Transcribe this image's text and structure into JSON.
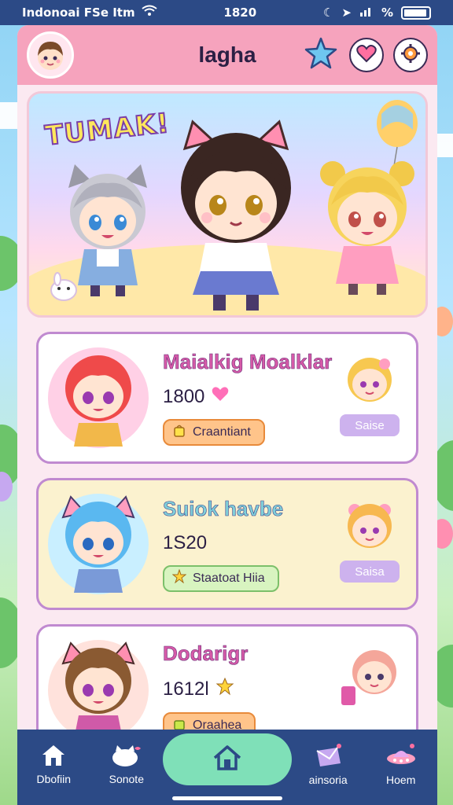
{
  "status_bar": {
    "carrier": "Indonoai FSe Itm",
    "time": "1820",
    "icons": [
      "wifi-icon",
      "moon-icon",
      "location-icon",
      "signal-icon",
      "battery-icon"
    ],
    "percent": "%"
  },
  "header": {
    "title": "lagha",
    "avatar_icon": "chibi-boy-avatar",
    "actions": [
      "star-icon",
      "heart-chat-icon",
      "gear-icon"
    ]
  },
  "banner": {
    "title": "TUMAK!",
    "characters": [
      "gray-cat-girl",
      "dark-hair-cat-girl",
      "blonde-bear-girl"
    ]
  },
  "cards": [
    {
      "name": "Maialkig Moalklar",
      "stat": "1800",
      "stat_icon": "heart-icon",
      "pill_label": "Craantiant",
      "pill_style": "orange",
      "side_label": "Saise",
      "accent": "#ffd0e6"
    },
    {
      "name": "Suiok havbe",
      "stat": "1S20",
      "stat_icon": "",
      "pill_label": "Staatoat Hiia",
      "pill_style": "green",
      "side_label": "Saisa",
      "accent": "#c9efff"
    },
    {
      "name": "Dodarigr",
      "stat": "1612l",
      "stat_icon": "star-icon",
      "pill_label": "Oraahea",
      "pill_style": "orange",
      "side_label": "",
      "accent": "#ffe2dc"
    }
  ],
  "bottom_nav": [
    {
      "label": "Dbofiin",
      "icon": "house-icon"
    },
    {
      "label": "Sonote",
      "icon": "cat-icon"
    },
    {
      "label": "",
      "icon": "home-icon",
      "active": true
    },
    {
      "label": "ainsoria",
      "icon": "envelope-icon"
    },
    {
      "label": "Hoem",
      "icon": "ufo-icon"
    }
  ],
  "colors": {
    "primary_bar": "#2c4a86",
    "header_pink": "#f6a3bd",
    "app_bg": "#fbe9f1",
    "active_nav": "#7fe0b8",
    "card_border": "#c08ad0"
  }
}
